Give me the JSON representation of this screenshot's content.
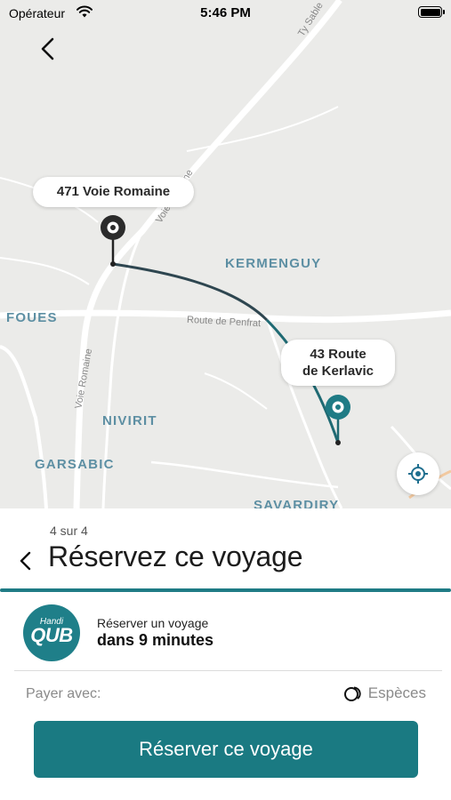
{
  "status_bar": {
    "carrier": "Opérateur",
    "time": "5:46 PM"
  },
  "map": {
    "places": [
      "KERMENGUY",
      "FOUES",
      "NIVIRIT",
      "GARSABIC",
      "SAVARDIRY"
    ],
    "roads": [
      "Route de Penfrat",
      "Voie Romaine",
      "Voie Romaine",
      "Ty Sable"
    ],
    "origin_label": "471 Voie Romaine",
    "destination_label_line1": "43 Route",
    "destination_label_line2": "de Kerlavic",
    "route_color": "#1f6a73",
    "icons": {
      "back": "chevron-left-icon",
      "locate": "crosshair-icon"
    }
  },
  "sheet": {
    "step": "4 sur 4",
    "title": "Réservez ce voyage",
    "logo_small": "Handi",
    "logo_big": "QUB",
    "reserve_label": "Réserver un voyage",
    "reserve_time": "dans 9 minutes",
    "pay_label": "Payer avec:",
    "pay_method": "Espèces",
    "cta": "Réserver ce voyage",
    "accent_color": "#1a7a82"
  }
}
